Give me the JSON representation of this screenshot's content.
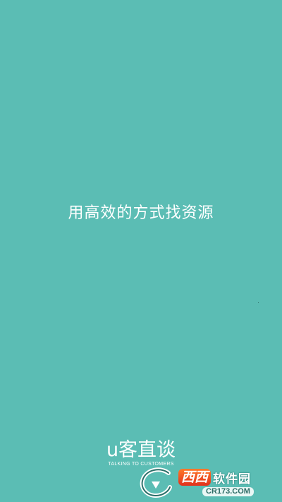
{
  "splash": {
    "slogan": "用高效的方式找资源",
    "brand_name": "u客直谈",
    "brand_tagline": "TALKING TO CUSTOMERS"
  },
  "watermark": {
    "badge": "西西",
    "label": "软件园",
    "url": "CR173.COM"
  },
  "colors": {
    "background": "#5bbdb4",
    "text": "#ffffff",
    "watermark_badge": "#e2301c"
  }
}
